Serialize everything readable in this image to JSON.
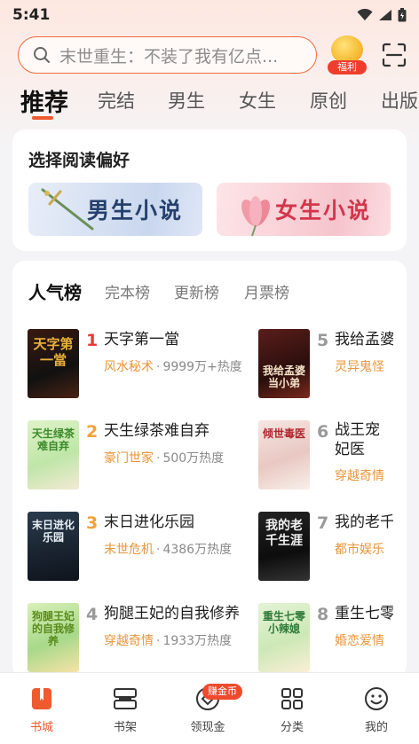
{
  "status": {
    "time": "5:41"
  },
  "search": {
    "placeholder": "末世重生：不装了我有亿点..."
  },
  "welfare": {
    "label": "福利"
  },
  "tabs": [
    "推荐",
    "完结",
    "男生",
    "女生",
    "原创",
    "出版"
  ],
  "preference": {
    "title": "选择阅读偏好",
    "male_label": "男生小说",
    "female_label": "女生小说"
  },
  "ranking": {
    "tabs": [
      "人气榜",
      "完本榜",
      "更新榜",
      "月票榜"
    ],
    "books": [
      {
        "rank": "1",
        "title": "天字第一當",
        "tag": "风水秘术",
        "heat": "9999万+热度",
        "cover_text": "天字第一當"
      },
      {
        "rank": "2",
        "title": "天生绿茶难自弃",
        "tag": "豪门世家",
        "heat": "500万热度",
        "cover_text": "天生绿茶难自弃"
      },
      {
        "rank": "3",
        "title": "末日进化乐园",
        "tag": "末世危机",
        "heat": "4386万热度",
        "cover_text": "末日进化乐园"
      },
      {
        "rank": "4",
        "title": "狗腿王妃的自我修养",
        "tag": "穿越奇情",
        "heat": "1933万热度",
        "cover_text": "狗腿王妃的自我修养"
      },
      {
        "rank": "5",
        "title": "我给孟婆",
        "tag": "灵异鬼怪",
        "heat": "",
        "cover_text": "我给孟婆当小弟"
      },
      {
        "rank": "6",
        "title": "战王宠妃医",
        "tag": "穿越奇情",
        "heat": "",
        "cover_text": "倾世毒医"
      },
      {
        "rank": "7",
        "title": "我的老千",
        "tag": "都市娱乐",
        "heat": "",
        "cover_text": "我的老千生涯"
      },
      {
        "rank": "8",
        "title": "重生七零",
        "tag": "婚恋爱情",
        "heat": "",
        "cover_text": "重生七零小辣媳"
      }
    ]
  },
  "bottom_nav": {
    "items": [
      "书城",
      "书架",
      "领现金",
      "分类",
      "我的"
    ],
    "badge": "赚金币"
  },
  "colors": {
    "accent": "#ef5a2e",
    "tag": "#e8953a",
    "rank_top": "#e8393a",
    "rank_mid": "#f0a23a",
    "rank_rest": "#9a9a9a"
  }
}
